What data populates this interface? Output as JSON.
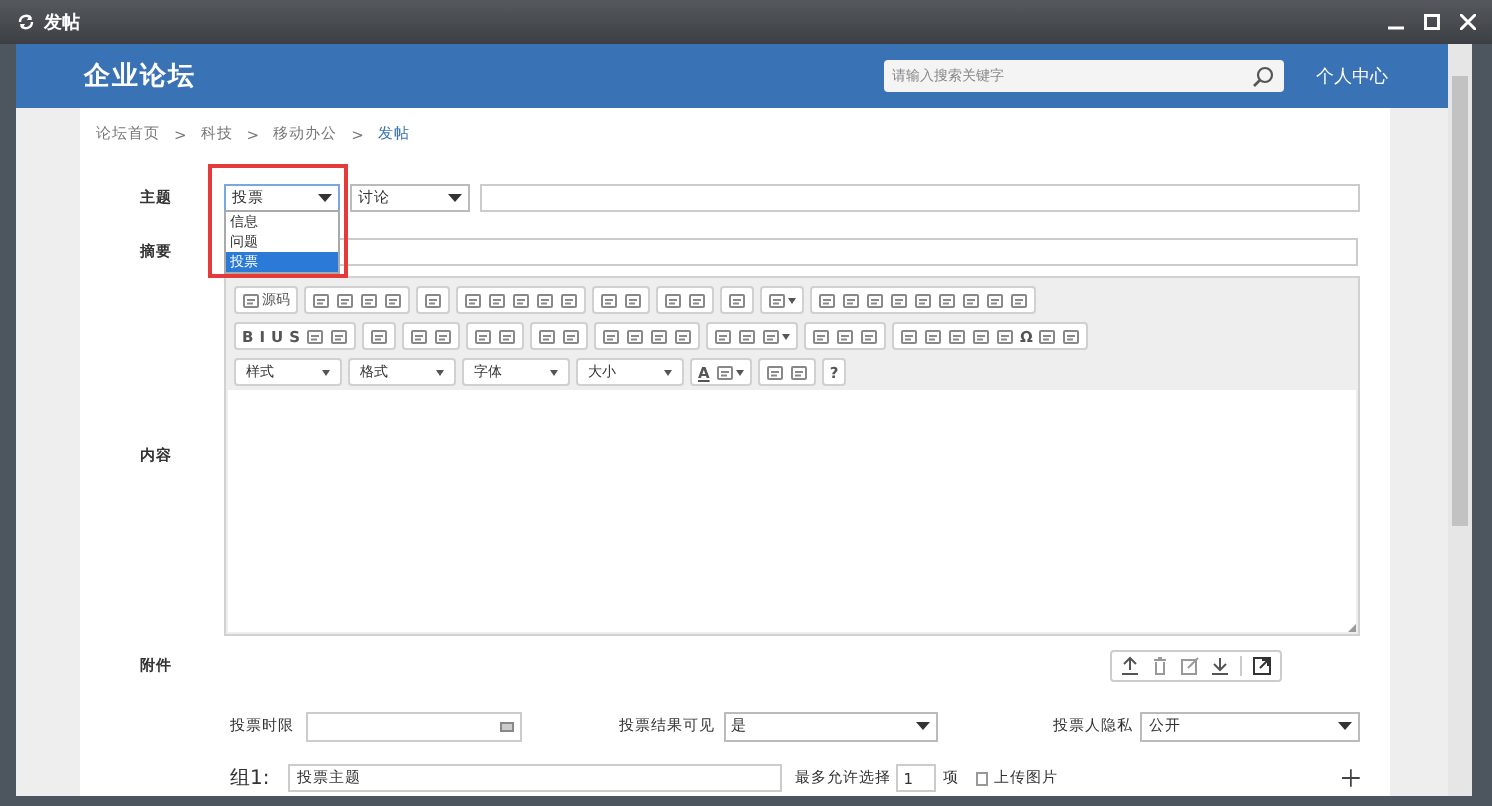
{
  "window": {
    "title": "发帖"
  },
  "header": {
    "logo": "企业论坛",
    "search": {
      "placeholder": "请输入搜索关键字"
    },
    "user_link": "个人中心"
  },
  "breadcrumb": [
    {
      "label": "论坛首页",
      "current": false
    },
    {
      "separator": ">",
      "label": "科技",
      "current": false
    },
    {
      "separator": ">",
      "label": "移动办公",
      "current": false
    },
    {
      "separator": ">",
      "label": "发帖",
      "current": true
    }
  ],
  "form": {
    "subject": {
      "label": "主题",
      "type_select": {
        "value": "投票",
        "expanded": true,
        "highlighted": true,
        "options": [
          {
            "label": "信息",
            "selected": false
          },
          {
            "label": "问题",
            "selected": false
          },
          {
            "label": "投票",
            "selected": true
          }
        ]
      },
      "category_select": {
        "value": "讨论"
      }
    },
    "summary": {
      "label": "摘要"
    },
    "content": {
      "label": "内容",
      "toolbar": [
        [
          [
            {
              "kind": "icon",
              "label": "源码"
            }
          ],
          [
            {
              "kind": "icon"
            },
            {
              "kind": "icon"
            },
            {
              "kind": "icon"
            },
            {
              "kind": "icon"
            }
          ],
          [
            {
              "kind": "icon"
            }
          ],
          [
            {
              "kind": "icon"
            },
            {
              "kind": "icon"
            },
            {
              "kind": "icon"
            },
            {
              "kind": "icon"
            },
            {
              "kind": "icon"
            }
          ],
          [
            {
              "kind": "icon"
            },
            {
              "kind": "icon"
            }
          ],
          [
            {
              "kind": "icon"
            },
            {
              "kind": "icon"
            }
          ],
          [
            {
              "kind": "icon"
            }
          ],
          [
            {
              "kind": "menu"
            }
          ],
          [
            {
              "kind": "icon"
            },
            {
              "kind": "icon"
            },
            {
              "kind": "icon"
            },
            {
              "kind": "icon"
            },
            {
              "kind": "icon"
            },
            {
              "kind": "icon"
            },
            {
              "kind": "icon"
            },
            {
              "kind": "icon"
            },
            {
              "kind": "icon"
            }
          ]
        ],
        [
          [
            {
              "kind": "text",
              "label": "B"
            },
            {
              "kind": "text",
              "label": "I"
            },
            {
              "kind": "text",
              "label": "U"
            },
            {
              "kind": "text",
              "label": "S"
            },
            {
              "kind": "icon"
            },
            {
              "kind": "icon"
            }
          ],
          [
            {
              "kind": "icon"
            }
          ],
          [
            {
              "kind": "icon"
            },
            {
              "kind": "icon"
            }
          ],
          [
            {
              "kind": "icon"
            },
            {
              "kind": "icon"
            }
          ],
          [
            {
              "kind": "icon"
            },
            {
              "kind": "icon"
            }
          ],
          [
            {
              "kind": "icon"
            },
            {
              "kind": "icon"
            },
            {
              "kind": "icon"
            },
            {
              "kind": "icon"
            }
          ],
          [
            {
              "kind": "icon"
            },
            {
              "kind": "icon"
            },
            {
              "kind": "menu"
            }
          ],
          [
            {
              "kind": "icon"
            },
            {
              "kind": "icon"
            },
            {
              "kind": "icon"
            }
          ],
          [
            {
              "kind": "icon"
            },
            {
              "kind": "icon"
            },
            {
              "kind": "icon"
            },
            {
              "kind": "icon"
            },
            {
              "kind": "icon"
            },
            {
              "kind": "text",
              "label": "Ω"
            },
            {
              "kind": "icon"
            },
            {
              "kind": "icon"
            }
          ]
        ],
        [
          [
            {
              "kind": "dropdown",
              "label": "样式"
            }
          ],
          [
            {
              "kind": "dropdown",
              "label": "格式"
            }
          ],
          [
            {
              "kind": "dropdown",
              "label": "字体"
            }
          ],
          [
            {
              "kind": "dropdown",
              "label": "大小"
            }
          ],
          [
            {
              "kind": "color",
              "label": "A"
            },
            {
              "kind": "menu"
            }
          ],
          [
            {
              "kind": "icon"
            },
            {
              "kind": "icon"
            }
          ],
          [
            {
              "kind": "text",
              "label": "?"
            }
          ]
        ]
      ]
    },
    "attachment": {
      "label": "附件"
    },
    "vote": {
      "deadline": {
        "label": "投票时限"
      },
      "visible": {
        "label": "投票结果可见",
        "value": "是"
      },
      "privacy": {
        "label": "投票人隐私",
        "value": "公开"
      },
      "groups": [
        {
          "label": "组1:",
          "value": "投票主题",
          "max_label": "最多允许选择",
          "max_value": "1",
          "unit": "项",
          "upload": {
            "label": "上传图片",
            "checked": false
          }
        }
      ]
    }
  }
}
